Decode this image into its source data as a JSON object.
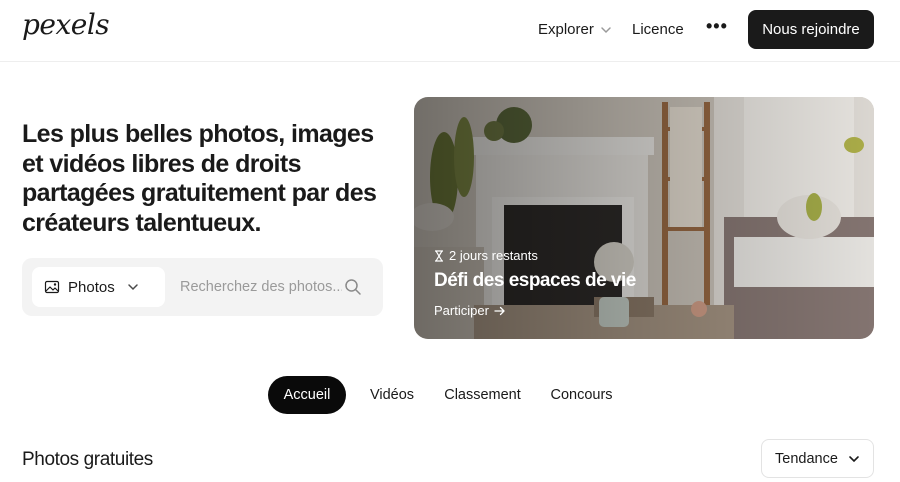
{
  "header": {
    "logo_text": "pexels",
    "nav": {
      "explorer_label": "Explorer",
      "licence_label": "Licence",
      "more_label": "•••"
    },
    "join_button_label": "Nous rejoindre"
  },
  "hero": {
    "title": "Les plus belles photos, images et vidéos libres de droits partagées gratuitement par des créateurs talentueux.",
    "search": {
      "type_selected": "Photos",
      "placeholder": "Recherchez des photos..."
    }
  },
  "challenge": {
    "days_left": "2 jours restants",
    "title": "Défi des espaces de vie",
    "cta_label": "Participer"
  },
  "tabs": [
    {
      "label": "Accueil",
      "active": true
    },
    {
      "label": "Vidéos",
      "active": false
    },
    {
      "label": "Classement",
      "active": false
    },
    {
      "label": "Concours",
      "active": false
    }
  ],
  "section": {
    "title": "Photos gratuites",
    "sort_label": "Tendance"
  },
  "colors": {
    "primary_dark": "#1a1a1a",
    "search_bg": "#f3f3f3",
    "placeholder": "#9a9a9a"
  }
}
